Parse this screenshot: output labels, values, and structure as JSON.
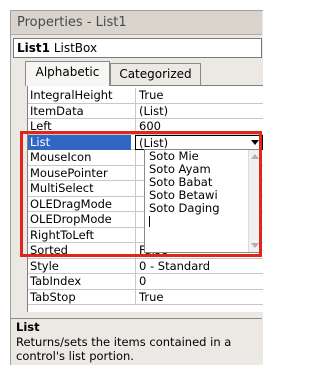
{
  "window": {
    "title": "Properties - List1"
  },
  "object_selector": {
    "name": "List1",
    "type": "ListBox"
  },
  "tabs": [
    {
      "label": "Alphabetic",
      "active": true
    },
    {
      "label": "Categorized",
      "active": false
    }
  ],
  "properties": [
    {
      "name": "IntegralHeight",
      "value": "True"
    },
    {
      "name": "ItemData",
      "value": "(List)"
    },
    {
      "name": "Left",
      "value": "600"
    },
    {
      "name": "List",
      "value": "(List)",
      "selected": true
    },
    {
      "name": "MouseIcon",
      "value": ""
    },
    {
      "name": "MousePointer",
      "value": ""
    },
    {
      "name": "MultiSelect",
      "value": ""
    },
    {
      "name": "OLEDragMode",
      "value": ""
    },
    {
      "name": "OLEDropMode",
      "value": ""
    },
    {
      "name": "RightToLeft",
      "value": ""
    },
    {
      "name": "Sorted",
      "value": "False"
    },
    {
      "name": "Style",
      "value": "0 - Standard"
    },
    {
      "name": "TabIndex",
      "value": "0"
    },
    {
      "name": "TabStop",
      "value": "True"
    }
  ],
  "list_dropdown": {
    "items": [
      "Soto Mie",
      "Soto Ayam",
      "Soto Babat",
      "Soto Betawi",
      "Soto Daging"
    ]
  },
  "description": {
    "title": "List",
    "text": "Returns/sets the items contained in a control's list portion."
  },
  "colors": {
    "selection": "#3166c2",
    "highlight_box": "#e0261a"
  }
}
